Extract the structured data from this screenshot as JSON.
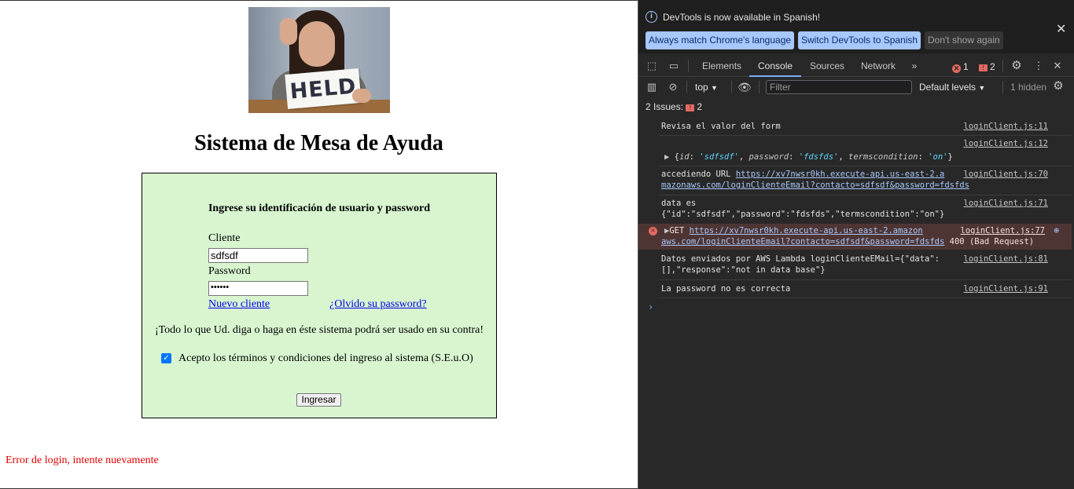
{
  "page": {
    "hero_sign": "HELD",
    "title": "Sistema de Mesa de Ayuda",
    "form": {
      "heading": "Ingrese su identificación de usuario y password",
      "cliente_label": "Cliente",
      "cliente_value": "sdfsdf",
      "password_label": "Password",
      "password_value": "••••••",
      "nuevo_cliente": "Nuevo cliente",
      "olvido": "¿Olvido su password?",
      "warning": "¡Todo lo que Ud. diga o haga en éste sistema podrá ser usado en su contra!",
      "accept_label": "Acepto los términos y condiciones del ingreso al sistema (S.E.u.O)",
      "accept_checked": true,
      "submit": "Ingresar"
    },
    "error": "Error de login, intente nuevamente"
  },
  "devtools": {
    "infobar": {
      "text": "DevTools is now available in Spanish!",
      "btn_match": "Always match Chrome's language",
      "btn_switch": "Switch DevTools to Spanish",
      "btn_dismiss": "Don't show again"
    },
    "tabs": [
      "Elements",
      "Console",
      "Sources",
      "Network"
    ],
    "active_tab": "Console",
    "error_count": "1",
    "issue_count": "2",
    "toolbar": {
      "context": "top",
      "filter_placeholder": "Filter",
      "levels": "Default levels",
      "hidden": "1 hidden"
    },
    "issues_label": "2 Issues:",
    "issues_count": "2",
    "console": {
      "r1_msg": "Revisa el valor del form",
      "r1_src": "loginClient.js:11",
      "r2_src": "loginClient.js:12",
      "r2_k1": "id",
      "r2_v1": "'sdfsdf'",
      "r2_k2": "password",
      "r2_v2": "'fdsfds'",
      "r2_k3": "termscondition",
      "r2_v3": "'on'",
      "r3_msg": "accediendo URL",
      "r3_url1": "https://xv7nwsr0kh.execute-api.us-east-2.a",
      "r3_url2": "mazonaws.com/loginClienteEmail?contacto=sdfsdf&password=fdsfds",
      "r3_src": "loginClient.js:70",
      "r4_msg1": "data es",
      "r4_msg2": "{\"id\":\"sdfsdf\",\"password\":\"fdsfds\",\"termscondition\":\"on\"}",
      "r4_src": "loginClient.js:71",
      "r5_method": "GET",
      "r5_url1": "https://xv7nwsr0kh.execute-api.us-east-2.amazon",
      "r5_url2": "aws.com/loginClienteEmail?contacto=sdfsdf&password=fdsfds",
      "r5_status": "400 (Bad Request)",
      "r5_src": "loginClient.js:77",
      "r6_msg1": "Datos enviados por AWS Lambda loginClienteEMail={\"data\":",
      "r6_msg2": "[],\"response\":\"not in data base\"}",
      "r6_src": "loginClient.js:81",
      "r7_msg": "La password no es correcta",
      "r7_src": "loginClient.js:91"
    }
  }
}
